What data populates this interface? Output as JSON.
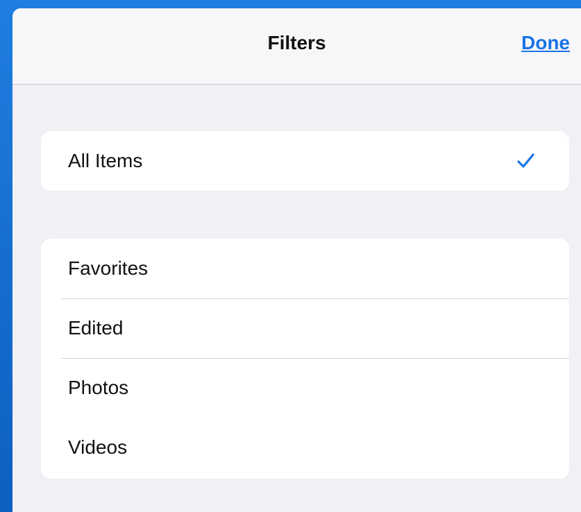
{
  "navbar": {
    "title": "Filters",
    "done_label": "Done"
  },
  "groups": [
    {
      "items": [
        {
          "label": "All Items",
          "selected": true,
          "icon": "checkmark-icon"
        }
      ]
    },
    {
      "items": [
        {
          "label": "Favorites",
          "selected": false
        },
        {
          "label": "Edited",
          "selected": false
        },
        {
          "label": "Photos",
          "selected": false
        },
        {
          "label": "Videos",
          "selected": false
        }
      ]
    }
  ],
  "colors": {
    "accent": "#1a73e8",
    "background": "#f0f0f5",
    "card": "#ffffff",
    "desktop": "#1a6fce"
  }
}
